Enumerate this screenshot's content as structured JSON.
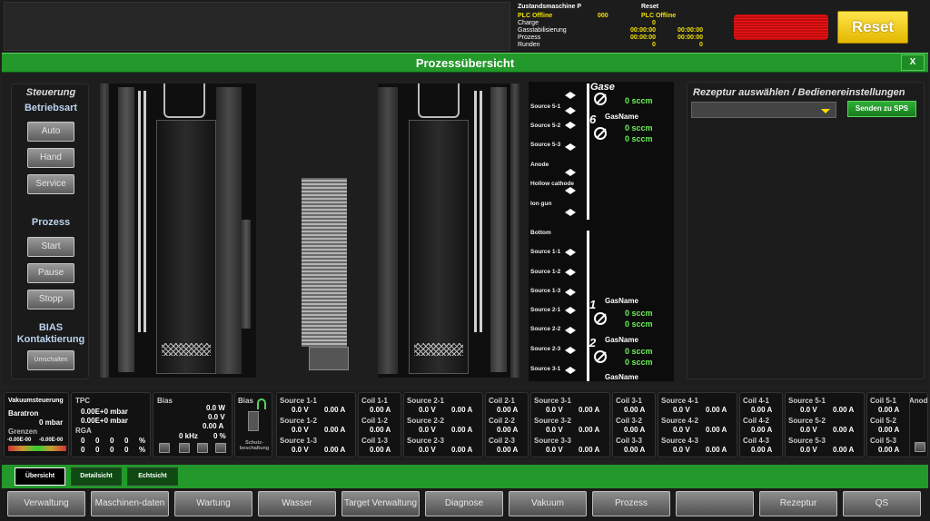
{
  "status": {
    "col1_title": "Zustandsmaschine P",
    "col2_title": "Reset",
    "plc1_label": "PLC Offline",
    "plc1_code": "000",
    "plc2_label": "PLC Offline",
    "rows": [
      {
        "label": "Charge",
        "v1": "",
        "v2": "0",
        "v3": ""
      },
      {
        "label": "Gasstabilisierung",
        "v1": "",
        "v2": "00:00:00",
        "v3": "00:00:00"
      },
      {
        "label": "Prozess",
        "v1": "",
        "v2": "00:00:00",
        "v3": "00:00:00"
      },
      {
        "label": "Runden",
        "v1": "",
        "v2": "0",
        "v3": "0"
      }
    ],
    "reset_button": "Reset"
  },
  "title": "Prozessübersicht",
  "close_label": "X",
  "steuerung": {
    "title": "Steuerung",
    "betriebsart": "Betriebsart",
    "mode_buttons": [
      "Auto",
      "Hand",
      "Service"
    ],
    "prozess": "Prozess",
    "process_buttons": [
      "Start",
      "Pause",
      "Stopp"
    ],
    "bias_title": "BIAS Kontaktierung",
    "bias_button": "Umschalten"
  },
  "gas": {
    "header": "Gase",
    "top_sources": [
      "Source 5-1",
      "Source 5-2",
      "Source 5-3",
      "Anode",
      "Hollow cathode",
      "Ion gun"
    ],
    "bottom_sources": [
      "Bottom",
      "Source 1-1",
      "Source 1-2",
      "Source 1-3",
      "Source 2-1",
      "Source 2-2",
      "Source 2-3",
      "Source 3-1"
    ],
    "mfcs": [
      {
        "num": "",
        "name": "",
        "flows": [
          "0 sccm"
        ]
      },
      {
        "num": "6",
        "name": "GasName",
        "flows": [
          "0 sccm",
          "0 sccm"
        ]
      },
      {
        "num": "1",
        "name": "GasName",
        "flows": [
          "0 sccm",
          "0 sccm"
        ]
      },
      {
        "num": "2",
        "name": "GasName",
        "flows": [
          "0 sccm",
          "0 sccm"
        ]
      },
      {
        "num": "",
        "name": "GasName",
        "flows": []
      }
    ]
  },
  "recipe": {
    "title": "Rezeptur auswählen / Bedienereinstellungen",
    "selected": "",
    "send_button": "Senden zu SPS"
  },
  "vacuum": {
    "title": "Vakuumsteuerung",
    "baratron": "Baratron",
    "baratron_value": "0 mbar",
    "grenzen": "Grenzen",
    "limit_lo": "-0.00E-00",
    "limit_hi": "-0.00E-00"
  },
  "tpc": {
    "title": "TPC",
    "v1": "0.00E+0 mbar",
    "v2": "0.00E+0 mbar",
    "rga": "RGA",
    "rga_row1": [
      "0",
      "0",
      "0",
      "0",
      "%"
    ],
    "rga_row2": [
      "0",
      "0",
      "0",
      "0",
      "%"
    ]
  },
  "bias": {
    "title": "Bias",
    "w": "0.0 W",
    "v": "0.0 V",
    "a": "0.00 A",
    "khz": "0 kHz",
    "pct": "0 %",
    "title2": "Bias",
    "schutz": "Schutz-beschaltung"
  },
  "sources": [
    {
      "name": "Source 1",
      "rows": [
        {
          "l": "Source 1-1",
          "v": "0.0 V",
          "a": "0.00 A"
        },
        {
          "l": "Source 1-2",
          "v": "0.0 V",
          "a": "0.00 A"
        },
        {
          "l": "Source 1-3",
          "v": "0.0 V",
          "a": "0.00 A"
        }
      ],
      "coils": [
        {
          "l": "Coil 1-1",
          "a": "0.00 A"
        },
        {
          "l": "Coil 1-2",
          "a": "0.00 A"
        },
        {
          "l": "Coil 1-3",
          "a": "0.00 A"
        }
      ]
    },
    {
      "name": "Source 2",
      "rows": [
        {
          "l": "Source 2-1",
          "v": "0.0 V",
          "a": "0.00 A"
        },
        {
          "l": "Source 2-2",
          "v": "0.0 V",
          "a": "0.00 A"
        },
        {
          "l": "Source 2-3",
          "v": "0.0 V",
          "a": "0.00 A"
        }
      ],
      "coils": [
        {
          "l": "Coil 2-1",
          "a": "0.00 A"
        },
        {
          "l": "Coil 2-2",
          "a": "0.00 A"
        },
        {
          "l": "Coil 2-3",
          "a": "0.00 A"
        }
      ]
    },
    {
      "name": "Source 3",
      "rows": [
        {
          "l": "Source 3-1",
          "v": "0.0 V",
          "a": "0.00 A"
        },
        {
          "l": "Source 3-2",
          "v": "0.0 V",
          "a": "0.00 A"
        },
        {
          "l": "Source 3-3",
          "v": "0.0 V",
          "a": "0.00 A"
        }
      ],
      "coils": [
        {
          "l": "Coil 3-1",
          "a": "0.00 A"
        },
        {
          "l": "Coil 3-2",
          "a": "0.00 A"
        },
        {
          "l": "Coil 3-3",
          "a": "0.00 A"
        }
      ]
    },
    {
      "name": "Source 4",
      "rows": [
        {
          "l": "Source 4-1",
          "v": "0.0 V",
          "a": "0.00 A"
        },
        {
          "l": "Source 4-2",
          "v": "0.0 V",
          "a": "0.00 A"
        },
        {
          "l": "Source 4-3",
          "v": "0.0 V",
          "a": "0.00 A"
        }
      ],
      "coils": [
        {
          "l": "Coil 4-1",
          "a": "0.00 A"
        },
        {
          "l": "Coil 4-2",
          "a": "0.00 A"
        },
        {
          "l": "Coil 4-3",
          "a": "0.00 A"
        }
      ]
    },
    {
      "name": "Source 5",
      "rows": [
        {
          "l": "Source 5-1",
          "v": "0.0 V",
          "a": "0.00 A"
        },
        {
          "l": "Source 5-2",
          "v": "0.0 V",
          "a": "0.00 A"
        },
        {
          "l": "Source 5-3",
          "v": "0.0 V",
          "a": "0.00 A"
        }
      ],
      "coils": [
        {
          "l": "Coil 5-1",
          "a": "0.00 A"
        },
        {
          "l": "Coil 5-2",
          "a": "0.00 A"
        },
        {
          "l": "Coil 5-3",
          "a": "0.00 A"
        }
      ]
    }
  ],
  "anode_label": "Anod",
  "tabs": [
    "Übersicht",
    "Detailsicht",
    "Echtsicht"
  ],
  "nav": [
    "Verwaltung",
    "Maschinen-daten",
    "Wartung",
    "Wasser",
    "Target Verwaltung",
    "Diagnose",
    "Vakuum",
    "Prozess",
    "",
    "Rezeptur",
    "QS"
  ],
  "colors": {
    "accent_green": "#22992a",
    "value_green": "#6df05a",
    "plc_yellow": "#f2e200",
    "reset_yellow": "#ffdc00"
  }
}
